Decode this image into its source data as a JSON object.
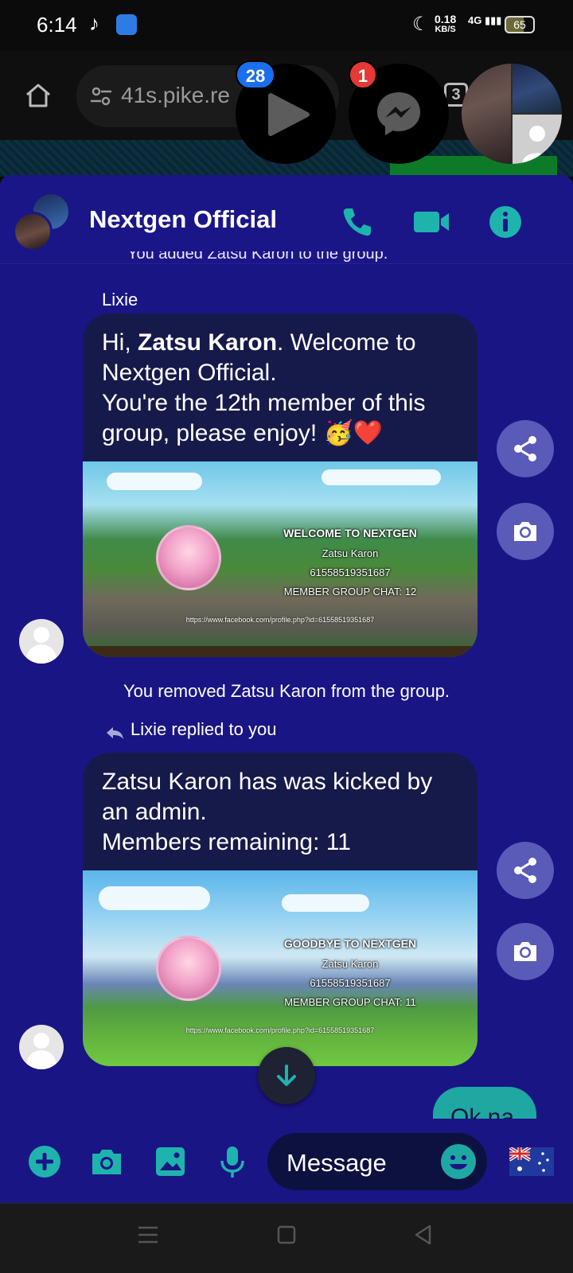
{
  "status_bar": {
    "time": "6:14",
    "speed_value": "0.18",
    "speed_unit": "KB/S",
    "network": "4G",
    "battery": "65"
  },
  "browser": {
    "url_fragment": "41s.pike.re",
    "tab_count": "3"
  },
  "chat_heads": {
    "video_badge": "28",
    "messenger_badge": "1"
  },
  "chat": {
    "title": "Nextgen Official",
    "header_icons": [
      "phone-icon",
      "video-call-icon",
      "info-icon"
    ],
    "partial_system_message": "You added Zatsu Karon to the group."
  },
  "messages": [
    {
      "sender": "Lixie",
      "greeting": "Hi, ",
      "name_bold": "Zatsu Karon",
      "text_line1_rest": ". Welcome to",
      "text_line2": "Nextgen Official.",
      "text_line3": "You're the 12th member of this",
      "text_line4": "group, please enjoy! 🥳❤️",
      "image": {
        "heading": "WELCOME TO NEXTGEN",
        "name": "Zatsu Karon",
        "id": "61558519351687",
        "member_line": "MEMBER GROUP CHAT: 12",
        "url": "https://www.facebook.com/profile.php?id=61558519351687"
      }
    },
    {
      "system": "You removed Zatsu Karon from the group."
    },
    {
      "reply_context": "Lixie replied to you",
      "text_line1": "Zatsu Karon has was kicked by",
      "text_line2": "an admin.",
      "text_line3": "Members remaining: 11",
      "image": {
        "heading": "GOODBYE TO NEXTGEN",
        "name": "Zatsu Karon",
        "id": "61558519351687",
        "member_line": "MEMBER GROUP CHAT: 11",
        "url": "https://www.facebook.com/profile.php?id=61558519351687"
      }
    },
    {
      "own_text": "Ok na"
    }
  ],
  "composer": {
    "placeholder": "Message"
  },
  "colors": {
    "panel": "#1a1585",
    "accent": "#1fa7a1",
    "bubble": "#161a4a"
  }
}
